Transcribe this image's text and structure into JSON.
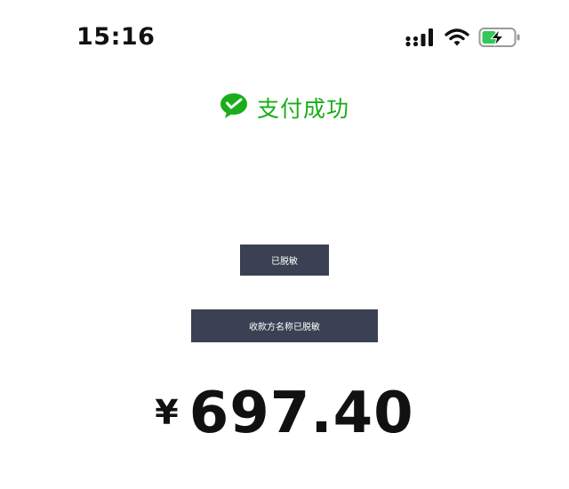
{
  "status_bar": {
    "time": "15:16",
    "signal_icon": "cellular-signal-icon",
    "wifi_icon": "wifi-icon",
    "battery_icon": "battery-charging-icon"
  },
  "header": {
    "logo_icon": "wechat-pay-icon",
    "title": "支付成功",
    "accent_color": "#1AAD19"
  },
  "masked": {
    "small_label": "已脱敏",
    "wide_label": "收款方名称已脱敏",
    "box_color": "#394152"
  },
  "payment": {
    "currency_symbol": "¥",
    "amount": "697.40"
  }
}
